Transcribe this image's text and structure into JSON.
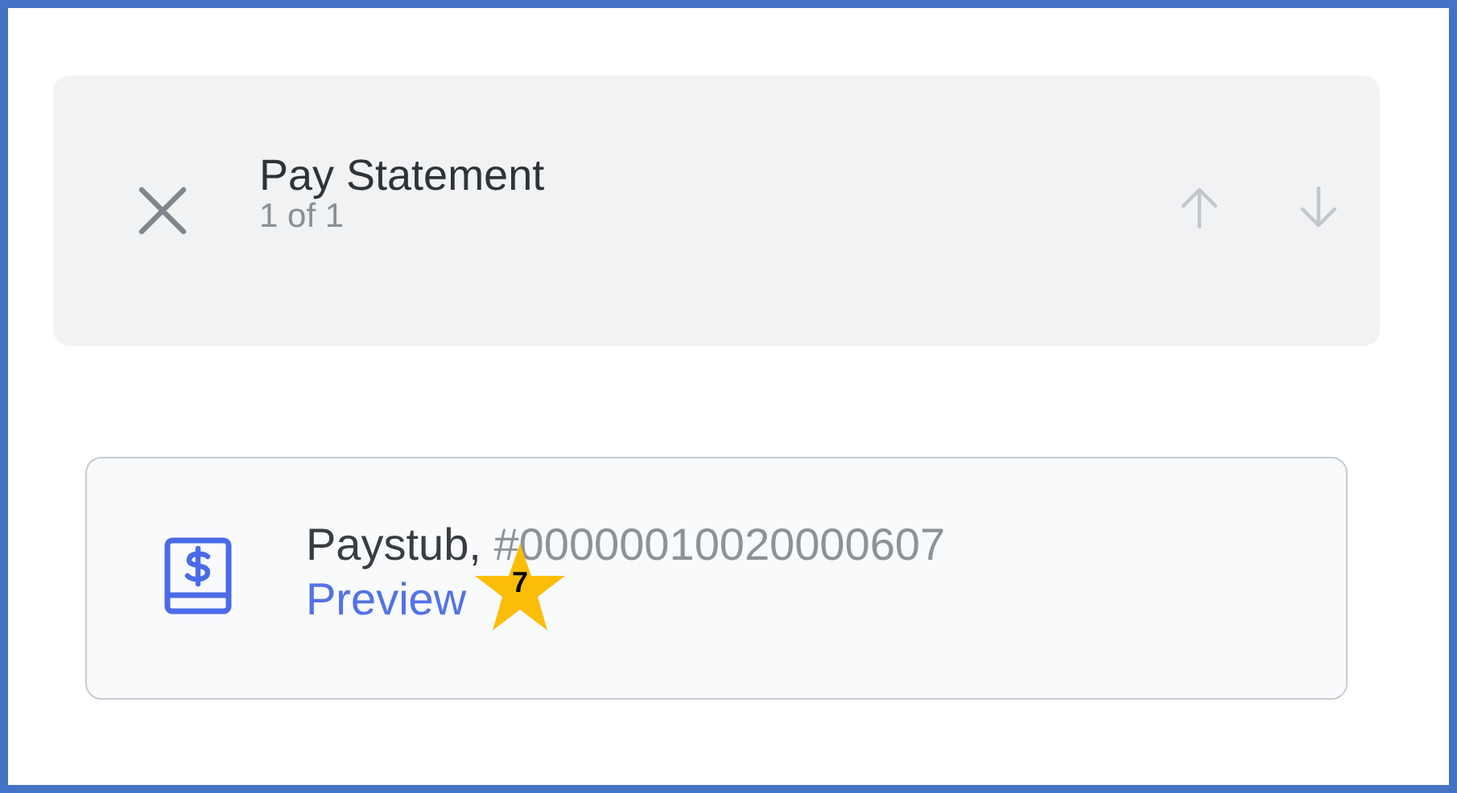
{
  "header": {
    "title": "Pay Statement",
    "counter": "1 of 1"
  },
  "document": {
    "name": "Paystub,",
    "number": "#00000010020000607",
    "link": "Preview"
  },
  "callout": {
    "number": "7"
  }
}
